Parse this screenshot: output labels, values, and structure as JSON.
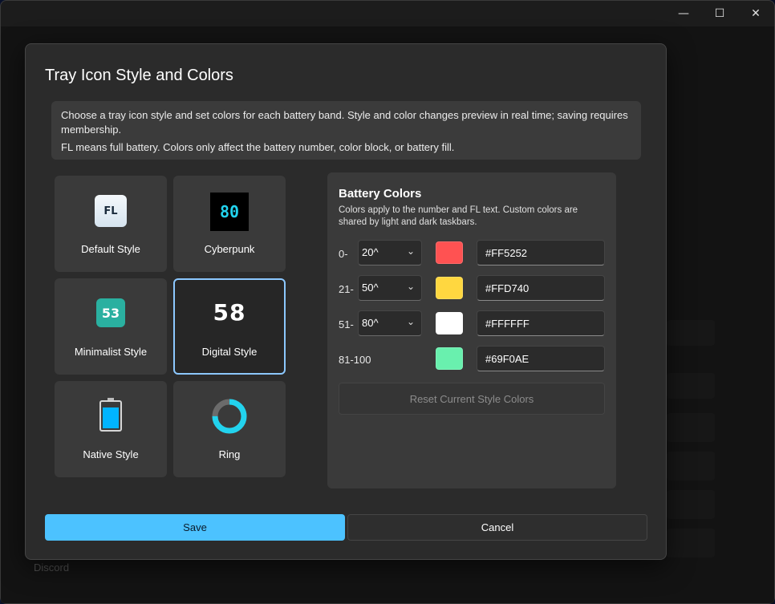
{
  "window": {
    "minimize_glyph": "—",
    "maximize_glyph": "☐",
    "close_glyph": "✕"
  },
  "background": {
    "sidebar_item": "Discord"
  },
  "dialog": {
    "title": "Tray Icon Style and Colors",
    "info": {
      "line1": "Choose a tray icon style and set colors for each battery band. Style and color changes preview in real time; saving requires membership.",
      "line2": "FL means full battery. Colors only affect the battery number, color block, or battery fill."
    },
    "styles": [
      {
        "label": "Default Style",
        "icon_text": "FL",
        "icon": "fl-badge-icon"
      },
      {
        "label": "Cyberpunk",
        "icon_text": "80",
        "icon": "cyberpunk-icon"
      },
      {
        "label": "Minimalist Style",
        "icon_text": "53",
        "icon": "minimalist-icon"
      },
      {
        "label": "Digital Style",
        "icon_text": "58",
        "icon": "digital-icon",
        "selected": true
      },
      {
        "label": "Native Style",
        "icon": "battery-icon"
      },
      {
        "label": "Ring",
        "icon": "ring-icon"
      }
    ],
    "battery_colors": {
      "title": "Battery Colors",
      "description": "Colors apply to the number and FL text. Custom colors are shared by light and dark taskbars.",
      "bands": [
        {
          "start": "0-",
          "end": "20",
          "color": "#FF5252"
        },
        {
          "start": "21-",
          "end": "50",
          "color": "#FFD740"
        },
        {
          "start": "51-",
          "end": "80",
          "color": "#FFFFFF"
        },
        {
          "start": "81-100",
          "color": "#69F0AE"
        }
      ],
      "spin_glyph": "^",
      "chevron_glyph": "⌄",
      "reset_label": "Reset Current Style Colors"
    },
    "save_label": "Save",
    "cancel_label": "Cancel"
  },
  "colors": {
    "accent": "#4CC2FF",
    "selected_border": "#8CC8FF",
    "native_battery_fill": "#00B4FF",
    "ring_fill": "#22D3EE"
  }
}
